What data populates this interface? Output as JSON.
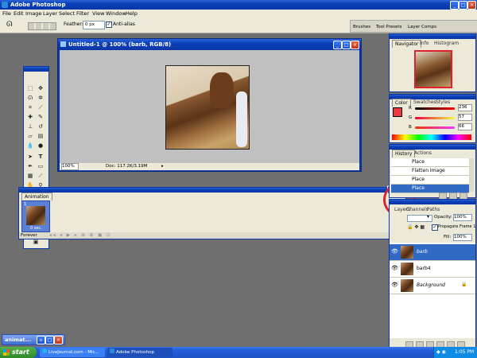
{
  "app": {
    "title": "Adobe Photoshop"
  },
  "menu": [
    "File",
    "Edit",
    "Image",
    "Layer",
    "Select",
    "Filter",
    "View",
    "Window",
    "Help"
  ],
  "options_bar": {
    "feather_label": "Feather:",
    "feather_value": "0 px",
    "antialias_label": "Anti-alias"
  },
  "palette_well": [
    "Brushes",
    "Tool Presets",
    "Layer Comps"
  ],
  "document": {
    "title": "Untitled-1 @ 100% (barb, RGB/8)",
    "zoom": "100%",
    "doc_info": "Doc: 117.2K/3.19M"
  },
  "navigator": {
    "tabs": [
      "Navigator",
      "Info",
      "Histogram"
    ]
  },
  "color": {
    "tabs": [
      "Color",
      "Swatches",
      "Styles"
    ],
    "r_label": "R",
    "r": "236",
    "g_label": "G",
    "g": "57",
    "b_label": "B",
    "b": "66",
    "fg": "#ec3942"
  },
  "history": {
    "tabs": [
      "History",
      "Actions"
    ],
    "items": [
      "Place",
      "Flatten Image",
      "Place",
      "Place"
    ]
  },
  "animation": {
    "title": "Animation",
    "frame_number": "1",
    "frame_delay": "0 sec.",
    "loop": "Forever"
  },
  "layers": {
    "tabs": [
      "Layers",
      "Channels",
      "Paths"
    ],
    "opacity_label": "Opacity:",
    "opacity": "100%",
    "propagate_label": "Propagate Frame 1",
    "fill_label": "Fill:",
    "fill": "100%",
    "items": [
      "barb",
      "barb4",
      "Background"
    ]
  },
  "minimized": {
    "title": "animat..."
  },
  "taskbar": {
    "start": "start",
    "tasks": [
      "LiveJournal.com - Mic...",
      "Adobe Photoshop"
    ],
    "clock": "1:05 PM"
  },
  "annotation_color": "#e0202a"
}
